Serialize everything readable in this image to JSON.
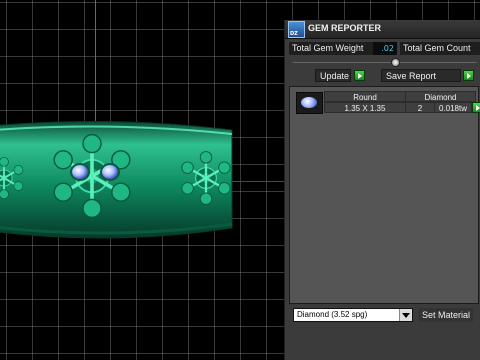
{
  "panel": {
    "title": "GEM REPORTER",
    "logo_text": "DZ",
    "total_gem_weight_label": "Total Gem Weight",
    "total_gem_weight_value": ".02",
    "total_gem_count_label": "Total Gem Count",
    "update_label": "Update",
    "save_report_label": "Save Report",
    "gem": {
      "shape": "Round",
      "type": "Diamond",
      "size": "1.35 X 1.35",
      "count": "2",
      "weight": "0.018tw"
    },
    "material_select": "Diamond    (3.52 spg)",
    "set_material_label": "Set Material"
  },
  "colors": {
    "panel_bg": "#3b3b3b",
    "value_text": "#58c6f0",
    "button_green": "#2fb82f",
    "ring_green": "#0f8f66"
  }
}
